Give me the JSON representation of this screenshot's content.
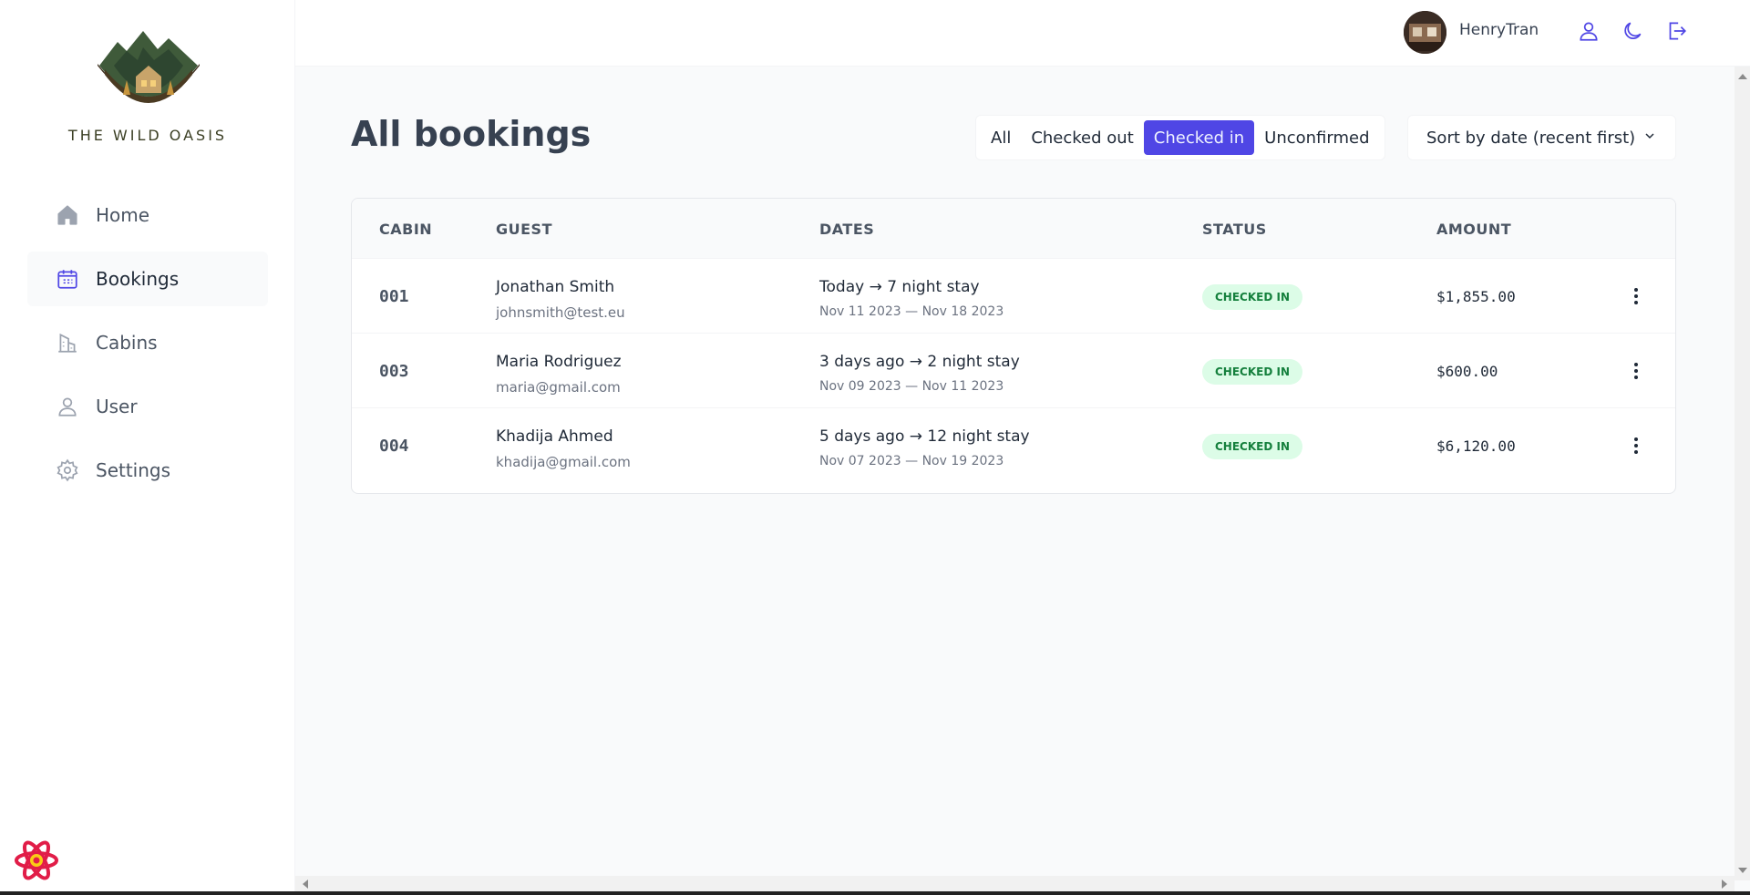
{
  "brand": {
    "name": "THE WILD OASIS"
  },
  "sidebar": {
    "items": [
      {
        "label": "Home",
        "icon": "home-icon",
        "active": false
      },
      {
        "label": "Bookings",
        "icon": "calendar-icon",
        "active": true
      },
      {
        "label": "Cabins",
        "icon": "building-icon",
        "active": false
      },
      {
        "label": "User",
        "icon": "user-icon",
        "active": false
      },
      {
        "label": "Settings",
        "icon": "gear-icon",
        "active": false
      }
    ]
  },
  "header": {
    "username": "HenryTran",
    "buttons": [
      "user-icon",
      "moon-icon",
      "logout-icon"
    ]
  },
  "main": {
    "title": "All bookings",
    "filters": [
      {
        "label": "All",
        "active": false
      },
      {
        "label": "Checked out",
        "active": false
      },
      {
        "label": "Checked in",
        "active": true
      },
      {
        "label": "Unconfirmed",
        "active": false
      }
    ],
    "sort": {
      "selected": "Sort by date (recent first)"
    },
    "table": {
      "columns": [
        "CABIN",
        "GUEST",
        "DATES",
        "STATUS",
        "AMOUNT"
      ],
      "rows": [
        {
          "cabin": "001",
          "guest": "Jonathan Smith",
          "email": "johnsmith@test.eu",
          "stay": "Today → 7 night stay",
          "range": "Nov 11 2023 — Nov 18 2023",
          "status": "CHECKED IN",
          "amount": "$1,855.00"
        },
        {
          "cabin": "003",
          "guest": "Maria Rodriguez",
          "email": "maria@gmail.com",
          "stay": "3 days ago → 2 night stay",
          "range": "Nov 09 2023 — Nov 11 2023",
          "status": "CHECKED IN",
          "amount": "$600.00"
        },
        {
          "cabin": "004",
          "guest": "Khadija Ahmed",
          "email": "khadija@gmail.com",
          "stay": "5 days ago → 12 night stay",
          "range": "Nov 07 2023 — Nov 19 2023",
          "status": "CHECKED IN",
          "amount": "$6,120.00"
        }
      ]
    }
  },
  "colors": {
    "accent": "#4f46e5",
    "status_bg": "#dcfce7",
    "status_text": "#15803d"
  }
}
